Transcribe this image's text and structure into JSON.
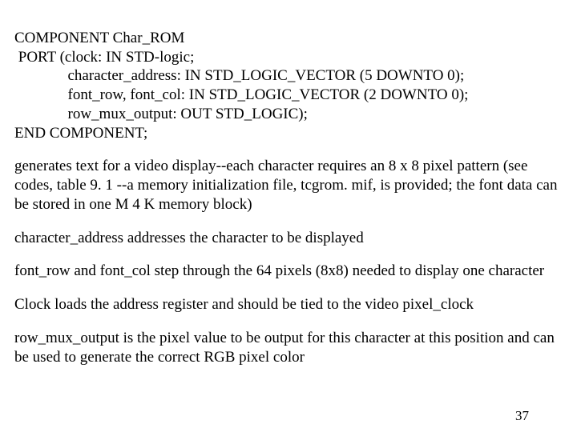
{
  "code": {
    "l1": "COMPONENT Char_ROM",
    "l2": " PORT (clock: IN STD-logic;",
    "l3": "              character_address: IN STD_LOGIC_VECTOR (5 DOWNTO 0);",
    "l4": "              font_row, font_col: IN STD_LOGIC_VECTOR (2 DOWNTO 0);",
    "l5": "              row_mux_output: OUT STD_LOGIC);",
    "l6": "END COMPONENT;"
  },
  "paragraphs": {
    "p1": "generates text for a video display--each character requires an 8 x 8 pixel pattern (see codes, table 9. 1 --a memory initialization file, tcgrom. mif, is provided; the font data can be stored in one M 4 K memory block)",
    "p2": "character_address addresses the character to be displayed",
    "p3": "font_row and font_col step through the 64 pixels (8x8) needed to display one character",
    "p4": "Clock loads the address register and should be tied to the video pixel_clock",
    "p5": "row_mux_output is the pixel value to be output for this character at this position and can be used to generate the correct RGB pixel color"
  },
  "page_number": "37"
}
